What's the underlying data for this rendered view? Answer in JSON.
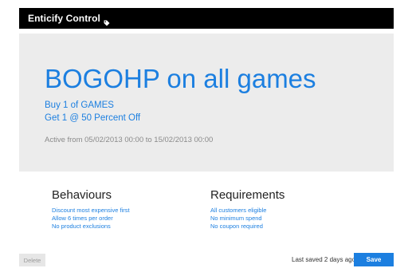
{
  "header": {
    "title": "Enticify Control",
    "icon": "tag-icon"
  },
  "promotion": {
    "headline": "BOGOHP on all games",
    "buy_line": "Buy 1 of GAMES",
    "get_line": "Get 1 @ 50 Percent Off",
    "active": "Active from 05/02/2013 00:00 to 15/02/2013 00:00"
  },
  "behaviours": {
    "title": "Behaviours",
    "items": [
      "Discount most expensive first",
      "Allow 6 times per order",
      "No product exclusions"
    ]
  },
  "requirements": {
    "title": "Requirements",
    "items": [
      "All customers eligible",
      "No minimum spend",
      "No coupon required"
    ]
  },
  "footer": {
    "delete_label": "Delete",
    "last_saved": "Last saved 2 days ago",
    "save_label": "Save"
  },
  "colors": {
    "accent": "#1c7fe0",
    "header_bg": "#000000",
    "hero_bg": "#ececec"
  }
}
